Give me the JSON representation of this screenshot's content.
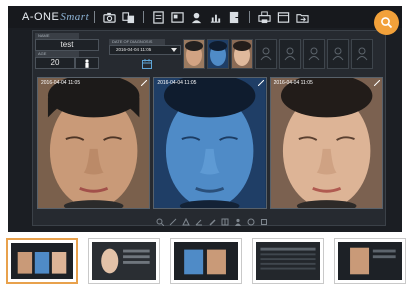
{
  "app": {
    "logo_main": "A-ONE",
    "logo_sub": "Smart",
    "toolbar_icons": [
      "camera-icon",
      "compare-icon",
      "report-icon",
      "layout-icon",
      "person-icon",
      "chart-icon",
      "export-icon",
      "print-icon",
      "window-icon",
      "folder-icon"
    ]
  },
  "form": {
    "name_label": "NAME",
    "name_value": "test",
    "age_label": "AGE",
    "age_value": "20"
  },
  "diagnosis": {
    "date_label": "DATE OF DIAGNOSIS",
    "date_value": "2016-04-04 11:05"
  },
  "images": [
    {
      "timestamp": "2016-04-04 11:05",
      "mode": "normal"
    },
    {
      "timestamp": "2016-04-04 11:05",
      "mode": "uv"
    },
    {
      "timestamp": "2016-04-04 11:05",
      "mode": "polarized"
    }
  ],
  "carousel": {
    "active_index": 0,
    "count": 5
  },
  "colors": {
    "accent": "#f2a13a",
    "app_bg": "#1b1e23",
    "uv_tint": "#3b79b8"
  }
}
